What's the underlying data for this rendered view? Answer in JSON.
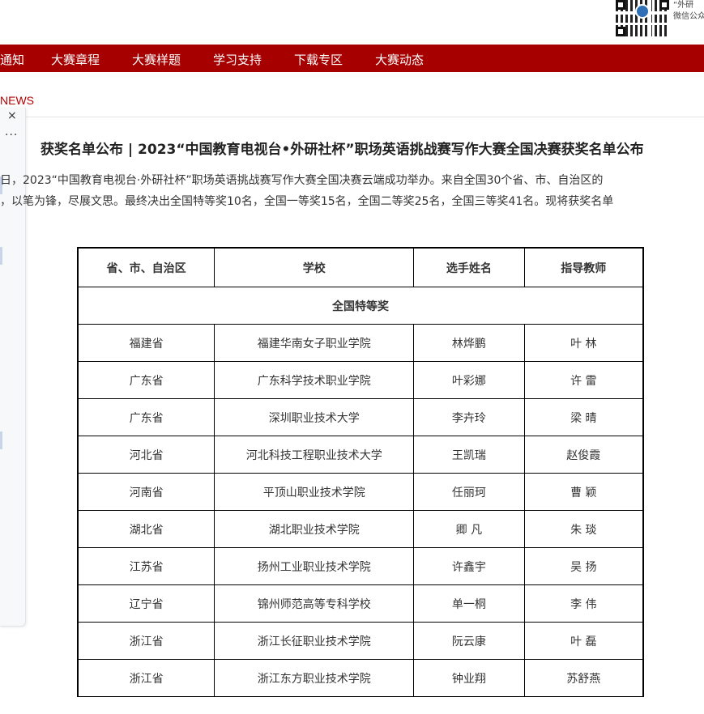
{
  "header": {
    "qr_caption_line1": "“外研",
    "qr_caption_line2": "微信公众"
  },
  "nav": {
    "items": [
      {
        "label": "通知"
      },
      {
        "label": "大赛章程"
      },
      {
        "label": "大赛样题"
      },
      {
        "label": "学习支持"
      },
      {
        "label": "下载专区"
      },
      {
        "label": "大赛动态"
      }
    ]
  },
  "section_label": "NEWS",
  "side_panel": {
    "close_glyph": "×",
    "more_glyph": "···"
  },
  "article": {
    "title": "获奖名单公布 | 2023“中国教育电视台•外研社杯”职场英语挑战赛写作大赛全国决赛获奖名单公布",
    "para_line1": "日，2023“中国教育电视台·外研社杯”职场英语挑战赛写作大赛全国决赛云端成功举办。来自全国30个省、市、自治区的",
    "para_line2": "，以笔为锋，尽展文思。最终决出全国特等奖10名，全国一等奖15名，全国二等奖25名，全国三等奖41名。现将获奖名单"
  },
  "table": {
    "headers": [
      "省、市、自治区",
      "学校",
      "选手姓名",
      "指导教师"
    ],
    "section": "全国特等奖",
    "rows": [
      [
        "福建省",
        "福建华南女子职业学院",
        "林烨鹏",
        "叶 林"
      ],
      [
        "广东省",
        "广东科学技术职业学院",
        "叶彩娜",
        "许 雷"
      ],
      [
        "广东省",
        "深圳职业技术大学",
        "李卉玲",
        "梁 晴"
      ],
      [
        "河北省",
        "河北科技工程职业技术大学",
        "王凯瑞",
        "赵俊霞"
      ],
      [
        "河南省",
        "平顶山职业技术学院",
        "任丽珂",
        "曹 颖"
      ],
      [
        "湖北省",
        "湖北职业技术学院",
        "卿 凡",
        "朱 琰"
      ],
      [
        "江苏省",
        "扬州工业职业技术学院",
        "许鑫宇",
        "吴 扬"
      ],
      [
        "辽宁省",
        "锦州师范高等专科学校",
        "单一桐",
        "李 伟"
      ],
      [
        "浙江省",
        "浙江长征职业技术学院",
        "阮云康",
        "叶 磊"
      ],
      [
        "浙江省",
        "浙江东方职业技术学院",
        "钟业翔",
        "苏舒燕"
      ]
    ]
  }
}
